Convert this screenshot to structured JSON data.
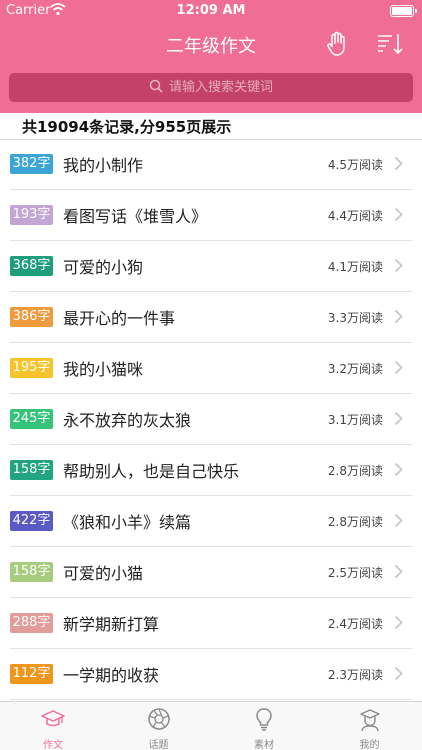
{
  "status_bar": {
    "carrier": "Carrier",
    "time": "12:09 AM"
  },
  "nav": {
    "title": "二年级作文"
  },
  "search": {
    "placeholder": "请输入搜索关键词"
  },
  "summary": "共19094条记录,分955页展示",
  "colors": {
    "brand": "#f06d95",
    "search_bg": "#c4426a"
  },
  "items": [
    {
      "count": "382字",
      "title": "我的小制作",
      "reads": "4.5万阅读",
      "badge_color": "#3aa5d6"
    },
    {
      "count": "193字",
      "title": "看图写话《堆雪人》",
      "reads": "4.4万阅读",
      "badge_color": "#c4a6d6"
    },
    {
      "count": "368字",
      "title": "可爱的小狗",
      "reads": "4.1万阅读",
      "badge_color": "#1f9e7a"
    },
    {
      "count": "386字",
      "title": "最开心的一件事",
      "reads": "3.3万阅读",
      "badge_color": "#f09a3e"
    },
    {
      "count": "195字",
      "title": "我的小猫咪",
      "reads": "3.2万阅读",
      "badge_color": "#f6c32b"
    },
    {
      "count": "245字",
      "title": "永不放弃的灰太狼",
      "reads": "3.1万阅读",
      "badge_color": "#35c47a"
    },
    {
      "count": "158字",
      "title": "帮助别人，也是自己快乐",
      "reads": "2.8万阅读",
      "badge_color": "#22a57e"
    },
    {
      "count": "422字",
      "title": "《狼和小羊》续篇",
      "reads": "2.8万阅读",
      "badge_color": "#5a5ac6"
    },
    {
      "count": "158字",
      "title": "可爱的小猫",
      "reads": "2.5万阅读",
      "badge_color": "#a8cc7e"
    },
    {
      "count": "288字",
      "title": "新学期新打算",
      "reads": "2.4万阅读",
      "badge_color": "#e29c9c"
    },
    {
      "count": "112字",
      "title": "一学期的收获",
      "reads": "2.3万阅读",
      "badge_color": "#f0961c"
    }
  ],
  "tabs": [
    {
      "label": "作文",
      "icon": "graduation-cap-icon",
      "active": true
    },
    {
      "label": "话题",
      "icon": "aperture-icon",
      "active": false
    },
    {
      "label": "素材",
      "icon": "lightbulb-icon",
      "active": false
    },
    {
      "label": "我的",
      "icon": "student-icon",
      "active": false
    }
  ]
}
